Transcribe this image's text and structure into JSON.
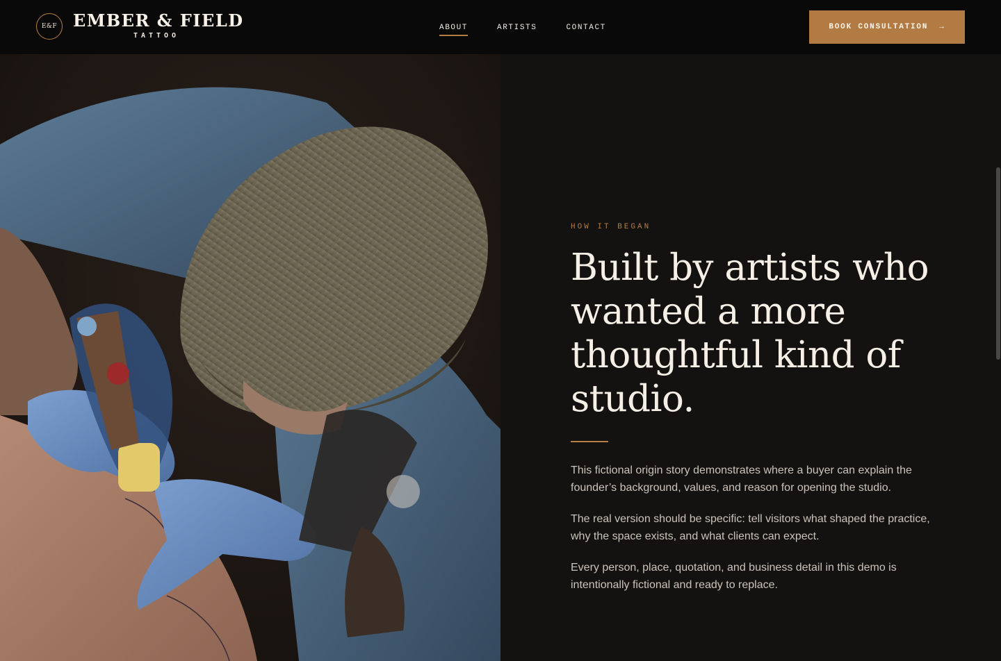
{
  "brand": {
    "badge": "E&F",
    "name": "EMBER & FIELD",
    "tagline": "TATTOO"
  },
  "nav": {
    "items": [
      {
        "label": "ABOUT",
        "active": true
      },
      {
        "label": "ARTISTS",
        "active": false
      },
      {
        "label": "CONTACT",
        "active": false
      }
    ]
  },
  "cta": {
    "label": "BOOK CONSULTATION",
    "arrow": "→"
  },
  "about": {
    "eyebrow": "HOW IT BEGAN",
    "heading": "Built by artists who wanted a more thoughtful kind of studio.",
    "paragraphs": [
      "This fictional origin story demonstrates where a buyer can explain the founder’s background, values, and reason for opening the studio.",
      "The real version should be specific: tell visitors what shaped the practice, why the space exists, and what clients can expect.",
      "Every person, place, quotation, and business detail in this demo is intentionally fictional and ready to replace."
    ]
  },
  "colors": {
    "background": "#141211",
    "accent": "#b17b43",
    "heading_text": "#f5efe6",
    "body_text": "#cbc3b9"
  },
  "photo": {
    "subject": "tattoo artist in beanie working with gloved hands"
  }
}
